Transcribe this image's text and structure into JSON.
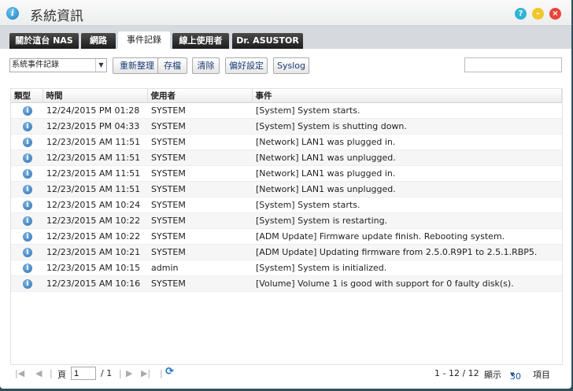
{
  "window": {
    "title": "系統資訊",
    "icons": [
      "info-icon",
      "help-icon",
      "minimize-icon",
      "close-icon"
    ]
  },
  "tabs": [
    {
      "label": "關於這台 NAS"
    },
    {
      "label": "網路"
    },
    {
      "label": "事件記錄",
      "active": true
    },
    {
      "label": "線上使用者"
    },
    {
      "label": "Dr. ASUSTOR"
    }
  ],
  "toolbar": {
    "log_select": "系統事件記錄",
    "refresh": "重新整理",
    "save": "存檔",
    "clear": "清除",
    "preferences": "偏好設定",
    "syslog": "Syslog",
    "search_value": ""
  },
  "table": {
    "headers": [
      "類型",
      "時間",
      "使用者",
      "事件"
    ],
    "rows": [
      {
        "time": "12/24/2015 PM 01:28",
        "user": "SYSTEM",
        "event": "[System] System starts."
      },
      {
        "time": "12/23/2015 PM 04:33",
        "user": "SYSTEM",
        "event": "[System] System is shutting down."
      },
      {
        "time": "12/23/2015 AM 11:51",
        "user": "SYSTEM",
        "event": "[Network] LAN1 was plugged in."
      },
      {
        "time": "12/23/2015 AM 11:51",
        "user": "SYSTEM",
        "event": "[Network] LAN1 was unplugged."
      },
      {
        "time": "12/23/2015 AM 11:51",
        "user": "SYSTEM",
        "event": "[Network] LAN1 was plugged in."
      },
      {
        "time": "12/23/2015 AM 11:51",
        "user": "SYSTEM",
        "event": "[Network] LAN1 was unplugged."
      },
      {
        "time": "12/23/2015 AM 10:24",
        "user": "SYSTEM",
        "event": "[System] System starts."
      },
      {
        "time": "12/23/2015 AM 10:22",
        "user": "SYSTEM",
        "event": "[System] System is restarting."
      },
      {
        "time": "12/23/2015 AM 10:22",
        "user": "SYSTEM",
        "event": "[ADM Update] Firmware update finish. Rebooting system."
      },
      {
        "time": "12/23/2015 AM 10:21",
        "user": "SYSTEM",
        "event": "[ADM Update] Updating firmware from 2.5.0.R9P1 to 2.5.1.RBP5."
      },
      {
        "time": "12/23/2015 AM 10:15",
        "user": "admin",
        "event": "[System] System is initialized."
      },
      {
        "time": "12/23/2015 AM 10:16",
        "user": "SYSTEM",
        "event": "[Volume] Volume 1 is good with support for 0 faulty disk(s)."
      }
    ]
  },
  "pager": {
    "page_label": "頁",
    "page": "1",
    "total": "/ 1",
    "range": "1 - 12 / 12",
    "show_label": "顯示",
    "per_page": "30",
    "items_label": "項目"
  }
}
